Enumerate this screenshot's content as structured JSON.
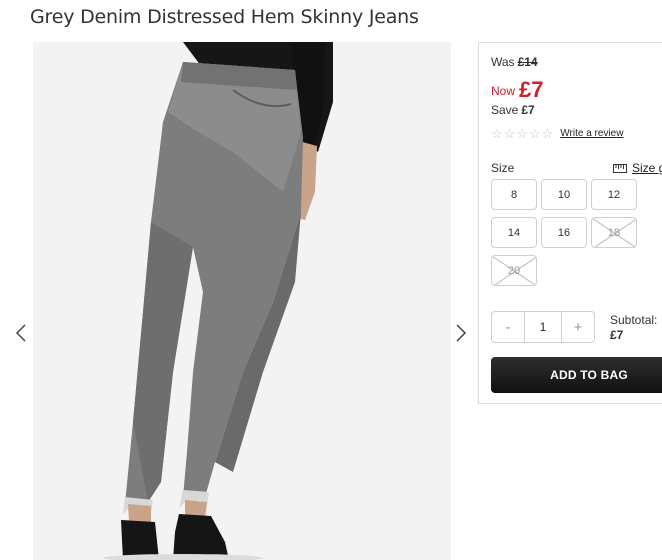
{
  "product": {
    "title": "Grey Denim Distressed Hem Skinny Jeans"
  },
  "pricing": {
    "was_label": "Was",
    "was_price": "£14",
    "now_label": "Now",
    "now_price": "£7",
    "save_label": "Save",
    "save_amount": "£7"
  },
  "reviews": {
    "stars_filled": 0,
    "stars_total": 5,
    "link": "Write a review"
  },
  "sizes": {
    "label": "Size",
    "guide_label": "Size g",
    "options": [
      {
        "label": "8",
        "available": true
      },
      {
        "label": "10",
        "available": true
      },
      {
        "label": "12",
        "available": true
      },
      {
        "label": "14",
        "available": true
      },
      {
        "label": "16",
        "available": true
      },
      {
        "label": "18",
        "available": false
      },
      {
        "label": "20",
        "available": false
      }
    ]
  },
  "quantity": {
    "minus": "-",
    "value": "1",
    "plus": "+"
  },
  "subtotal": {
    "label": "Subtotal:",
    "value": "£7"
  },
  "actions": {
    "add_to_bag": "ADD TO BAG"
  },
  "colors": {
    "sale_red": "#d0202e",
    "button_dark": "#1f1f1f",
    "border_grey": "#cfcfcf"
  },
  "icons": {
    "prev": "chevron-left-icon",
    "next": "chevron-right-icon",
    "ruler": "ruler-icon",
    "star": "star-outline-icon"
  }
}
